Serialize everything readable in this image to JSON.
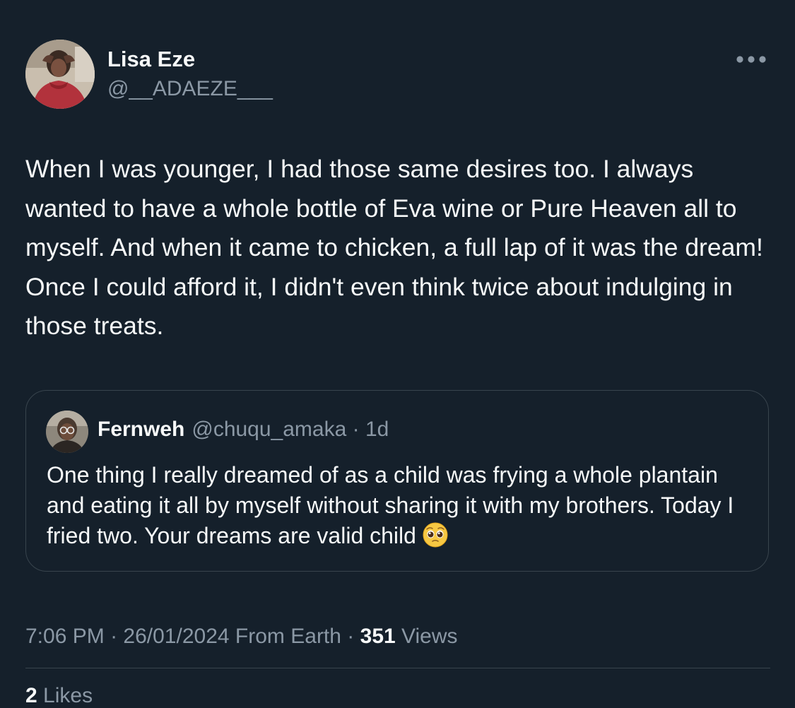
{
  "tweet": {
    "author": {
      "name": "Lisa Eze",
      "handle": "@__ADAEZE___"
    },
    "text": "When I was younger, I had those same desires too. I always wanted to have a whole bottle of Eva wine or Pure Heaven all to myself. And when it came to chicken, a full lap of it was the dream! Once I could afford it, I didn't even think twice about indulging in those treats.",
    "more_icon": "more-horizontal-icon",
    "quoted": {
      "name": "Fernweh",
      "handle": "@chuqu_amaka",
      "separator": "·",
      "age": "1d",
      "text": "One thing I really dreamed of as a child was frying a whole plantain and eating it all by myself without sharing it with my brothers. Today I fried two. Your dreams are valid child",
      "emoji": "pleading-face-emoji"
    },
    "meta": {
      "time": "7:06 PM",
      "separator1": "·",
      "date": "26/01/2024",
      "source": "From Earth",
      "separator2": "·",
      "views_count": "351",
      "views_label": "Views"
    },
    "likes": {
      "count": "2",
      "label": "Likes"
    }
  },
  "colors": {
    "background": "#15202b",
    "text_primary": "#f7f9f9",
    "text_secondary": "#8b98a5",
    "border": "#38444d"
  }
}
